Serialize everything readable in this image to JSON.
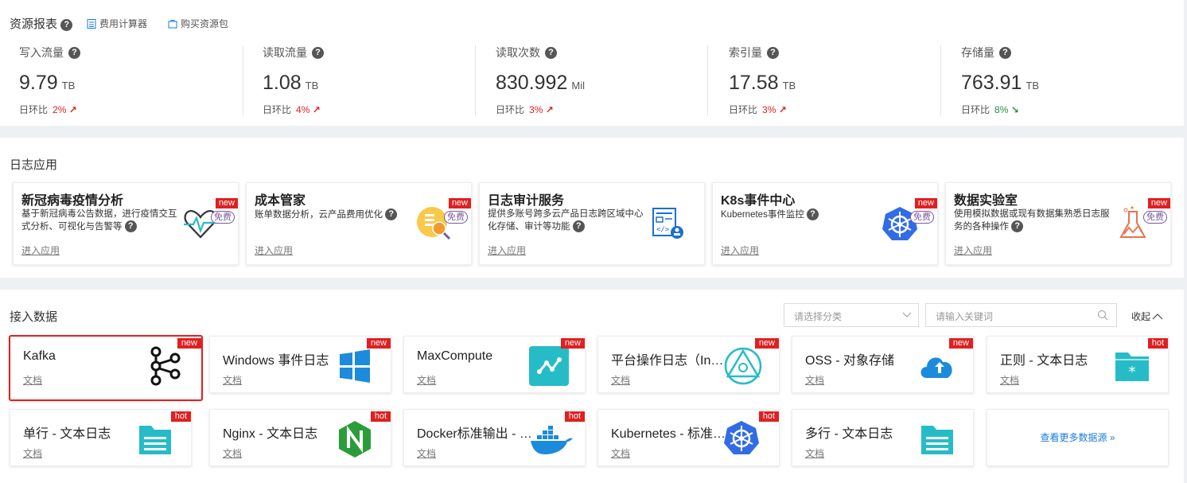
{
  "resource": {
    "title": "资源报表",
    "calculator": "费用计算器",
    "buy": "购买资源包",
    "metrics": [
      {
        "label": "写入流量",
        "value": "9.79",
        "unit": "TB",
        "cmp_label": "日环比",
        "pct": "2%",
        "arrow": "↗",
        "dir": "up"
      },
      {
        "label": "读取流量",
        "value": "1.08",
        "unit": "TB",
        "cmp_label": "日环比",
        "pct": "4%",
        "arrow": "↗",
        "dir": "up"
      },
      {
        "label": "读取次数",
        "value": "830.992",
        "unit": "Mil",
        "cmp_label": "日环比",
        "pct": "3%",
        "arrow": "↗",
        "dir": "up"
      },
      {
        "label": "索引量",
        "value": "17.58",
        "unit": "TB",
        "cmp_label": "日环比",
        "pct": "3%",
        "arrow": "↗",
        "dir": "up"
      },
      {
        "label": "存储量",
        "value": "763.91",
        "unit": "TB",
        "cmp_label": "日环比",
        "pct": "8%",
        "arrow": "↘",
        "dir": "down"
      }
    ]
  },
  "apps": {
    "title": "日志应用",
    "enter_label": "进入应用",
    "new_label": "new",
    "free_label": "免费",
    "items": [
      {
        "title": "新冠病毒疫情分析",
        "desc": "基于新冠病毒公告数据，进行疫情交互式分析、可视化与告警等",
        "icon": "heartbeat-icon"
      },
      {
        "title": "成本管家",
        "desc": "账单数据分析，云产品费用优化",
        "icon": "cost-coin-icon"
      },
      {
        "title": "日志审计服务",
        "desc": "提供多账号跨多云产品日志跨区域中心化存储、审计等功能",
        "icon": "audit-doc-icon"
      },
      {
        "title": "K8s事件中心",
        "desc": "Kubernetes事件监控",
        "icon": "kubernetes-icon"
      },
      {
        "title": "数据实验室",
        "desc": "使用模拟数据或现有数据集熟悉日志服务的各种操作",
        "icon": "flask-icon"
      }
    ]
  },
  "data_sources": {
    "title": "接入数据",
    "category_placeholder": "请选择分类",
    "search_placeholder": "请输入关键词",
    "collapse_label": "收起",
    "doc_label": "文档",
    "more_label": "查看更多数据源 »",
    "cards": [
      {
        "name": "Kafka",
        "tag": "new",
        "icon": "kafka-icon"
      },
      {
        "name": "Windows 事件日志",
        "tag": "new",
        "icon": "windows-icon"
      },
      {
        "name": "MaxCompute",
        "tag": "new",
        "icon": "maxcompute-icon"
      },
      {
        "name": "平台操作日志（Inn…",
        "tag": "new",
        "icon": "platform-triangle-icon"
      },
      {
        "name": "OSS - 对象存储",
        "tag": "new",
        "icon": "oss-cloud-icon"
      },
      {
        "name": "正则 - 文本日志",
        "tag": "hot",
        "icon": "folder-star-icon"
      },
      {
        "name": "单行 - 文本日志",
        "tag": "hot",
        "icon": "folder-icon"
      },
      {
        "name": "Nginx - 文本日志",
        "tag": "hot",
        "icon": "nginx-icon"
      },
      {
        "name": "Docker标准输出 - …",
        "tag": "hot",
        "icon": "docker-icon"
      },
      {
        "name": "Kubernetes - 标准…",
        "tag": "hot",
        "icon": "kubernetes-icon"
      },
      {
        "name": "多行 - 文本日志",
        "tag": "",
        "icon": "folder-icon"
      }
    ]
  },
  "colors": {
    "up": "#e02020",
    "down": "#1e8e3e",
    "accent": "#1a7bdb",
    "teal": "#26bcc7",
    "highlight": "#e02020"
  }
}
